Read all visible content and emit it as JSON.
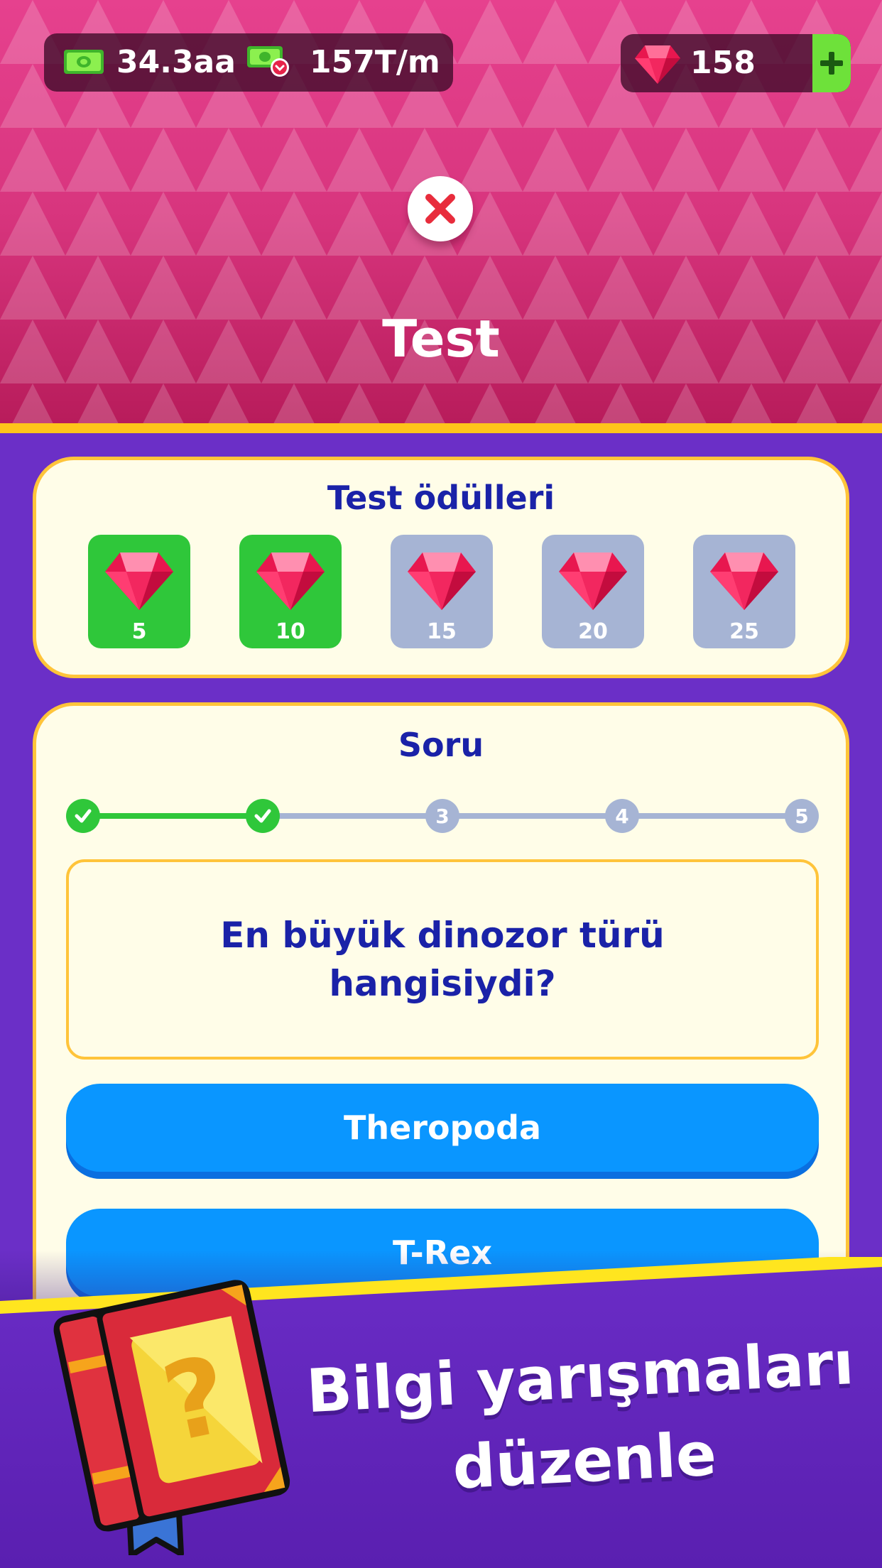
{
  "header": {
    "cash": "34.3aa",
    "income_rate": "157T/m",
    "gems": "158",
    "title": "Test"
  },
  "rewards": {
    "title": "Test ödülleri",
    "items": [
      {
        "value": "5",
        "earned": true
      },
      {
        "value": "10",
        "earned": true
      },
      {
        "value": "15",
        "earned": false
      },
      {
        "value": "20",
        "earned": false
      },
      {
        "value": "25",
        "earned": false
      }
    ]
  },
  "question_card": {
    "title": "Soru",
    "steps": [
      {
        "label": "",
        "done": true
      },
      {
        "label": "",
        "done": true
      },
      {
        "label": "3",
        "done": false
      },
      {
        "label": "4",
        "done": false
      },
      {
        "label": "5",
        "done": false
      }
    ],
    "question": "En büyük dinozor türü hangisiydi?",
    "answers": [
      "Theropoda",
      "T-Rex"
    ]
  },
  "banner": {
    "line1": "Bilgi yarışmaları",
    "line2": "düzenle"
  },
  "colors": {
    "header_pink": "#e6418e",
    "stripe_yellow": "#ffc41a",
    "background_purple": "#6b2fc7",
    "card_cream": "#fffde8",
    "title_blue": "#1a22a8",
    "earned_green": "#2fc73a",
    "locked_gray": "#a6b4d4",
    "answer_blue": "#0a96ff",
    "plus_green": "#6ee13a"
  }
}
